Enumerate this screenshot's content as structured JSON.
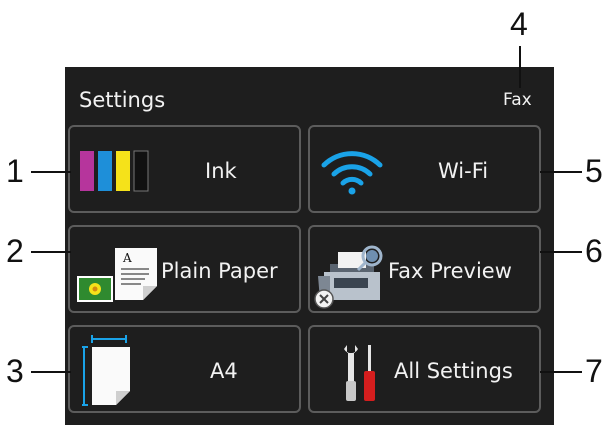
{
  "screen": {
    "title": "Settings",
    "mode": "Fax"
  },
  "tiles": [
    {
      "label": "Ink"
    },
    {
      "label": "Wi-Fi"
    },
    {
      "label": "Plain Paper"
    },
    {
      "label": "Fax Preview"
    },
    {
      "label": "A4"
    },
    {
      "label": "All Settings"
    }
  ],
  "callouts": [
    "1",
    "2",
    "3",
    "4",
    "5",
    "6",
    "7"
  ],
  "icons": [
    "ink-cartridges-icon",
    "wifi-icon",
    "paper-type-icon",
    "fax-preview-icon",
    "paper-size-icon",
    "tools-icon",
    "off-status-icon"
  ],
  "colors": {
    "ink_magenta": "#b6359c",
    "ink_cyan": "#1e8fd9",
    "ink_yellow": "#f5e21a",
    "ink_black": "#111111",
    "wifi": "#1aa3e8",
    "screen_bg": "#1e1e1e"
  }
}
